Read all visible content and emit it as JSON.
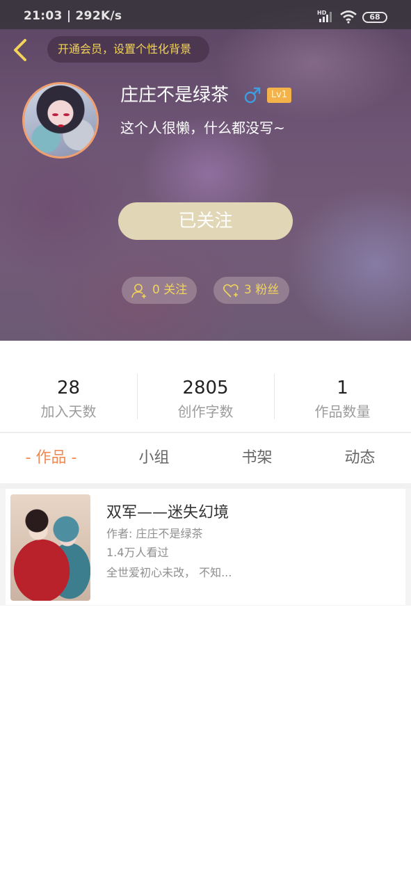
{
  "status_bar": {
    "time": "21:03 | 292K/s",
    "hd": "HD",
    "battery": "68"
  },
  "header": {
    "vip_prompt": "开通会员，设置个性化背景"
  },
  "profile": {
    "username": "庄庄不是绿茶",
    "gender_symbol": "♂",
    "level": "Lv1",
    "bio": "这个人很懒，什么都没写~",
    "follow_button": "已关注",
    "following_label": "0 关注",
    "fans_label": "3 粉丝"
  },
  "stats": [
    {
      "value": "28",
      "label": "加入天数"
    },
    {
      "value": "2805",
      "label": "创作字数"
    },
    {
      "value": "1",
      "label": "作品数量"
    }
  ],
  "tabs": [
    {
      "label": "- 作品 -",
      "active": true
    },
    {
      "label": "小组",
      "active": false
    },
    {
      "label": "书架",
      "active": false
    },
    {
      "label": "动态",
      "active": false
    }
  ],
  "works": [
    {
      "title": "双军——迷失幻境",
      "author": "作者: 庄庄不是绿茶",
      "views": "1.4万人看过",
      "description": "全世爱初心未改， 不知..."
    }
  ],
  "colors": {
    "accent_orange": "#ef8a55",
    "vip_yellow": "#f2d45a",
    "follow_button_bg": "#e1d6b5",
    "level_badge_bg": "#f3b34a",
    "gender_blue": "#3d9fe0"
  }
}
